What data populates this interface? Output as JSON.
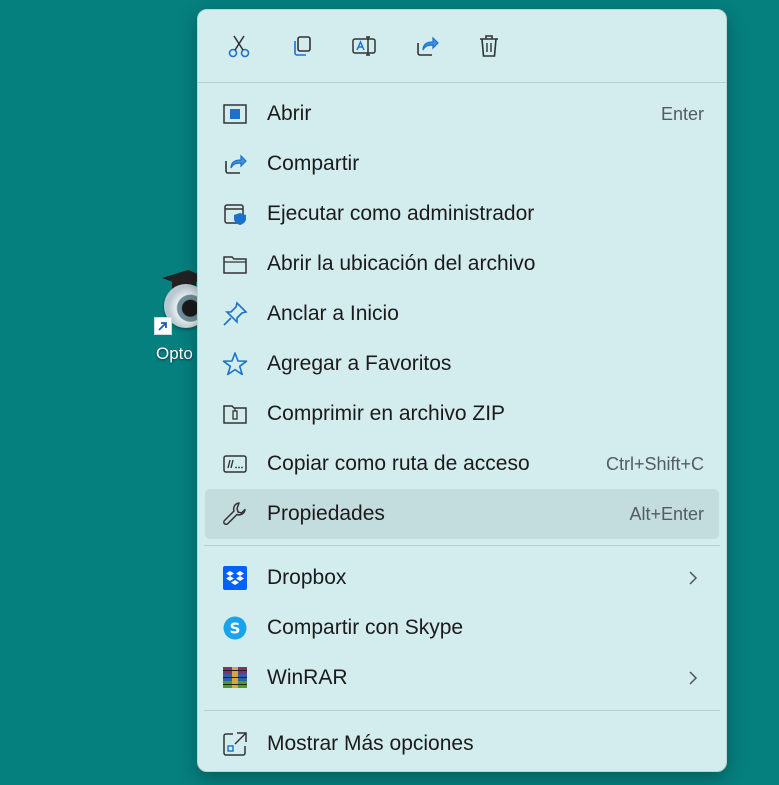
{
  "desktop": {
    "shortcut_label": "Opto"
  },
  "toolbar": {
    "cut_icon": "scissors-icon",
    "copy_icon": "copy-icon",
    "rename_icon": "rename-icon",
    "share_icon": "share-icon",
    "delete_icon": "trash-icon"
  },
  "menu": {
    "items": [
      {
        "label": "Abrir",
        "shortcut": "Enter",
        "icon": "open-window-icon"
      },
      {
        "label": "Compartir",
        "shortcut": "",
        "icon": "share-icon"
      },
      {
        "label": "Ejecutar como administrador",
        "shortcut": "",
        "icon": "shield-admin-icon"
      },
      {
        "label": "Abrir la ubicación del archivo",
        "shortcut": "",
        "icon": "folder-icon"
      },
      {
        "label": "Anclar a Inicio",
        "shortcut": "",
        "icon": "pin-icon"
      },
      {
        "label": "Agregar a Favoritos",
        "shortcut": "",
        "icon": "star-icon"
      },
      {
        "label": "Comprimir en archivo ZIP",
        "shortcut": "",
        "icon": "zip-folder-icon"
      },
      {
        "label": "Copiar como ruta de acceso",
        "shortcut": "Ctrl+Shift+C",
        "icon": "path-icon"
      },
      {
        "label": "Propiedades",
        "shortcut": "Alt+Enter",
        "icon": "wrench-icon"
      }
    ],
    "apps": [
      {
        "label": "Dropbox",
        "icon": "dropbox-icon",
        "submenu": true
      },
      {
        "label": "Compartir con Skype",
        "icon": "skype-icon",
        "submenu": false
      },
      {
        "label": "WinRAR",
        "icon": "winrar-icon",
        "submenu": true
      }
    ],
    "more": {
      "label": "Mostrar Más opciones",
      "icon": "more-options-icon"
    }
  },
  "colors": {
    "desktop": "#067f7f",
    "menu_bg": "#d3ecee",
    "accent": "#1a73c8"
  }
}
